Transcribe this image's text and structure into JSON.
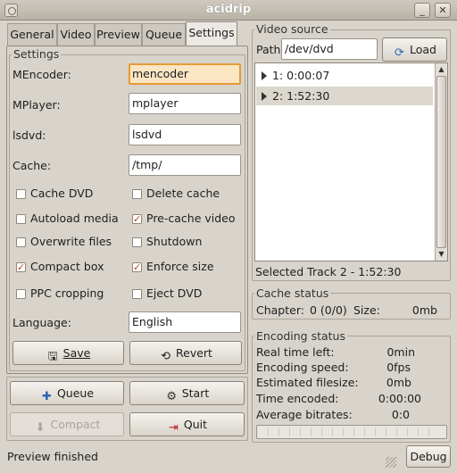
{
  "window": {
    "title": "acidrip",
    "minimize_glyph": "_",
    "close_glyph": "✕"
  },
  "tabs": [
    {
      "label": "General"
    },
    {
      "label": "Video"
    },
    {
      "label": "Preview"
    },
    {
      "label": "Queue"
    },
    {
      "label": "Settings",
      "active": true
    }
  ],
  "settings": {
    "group_label": "Settings",
    "mencoder": {
      "label": "MEncoder:",
      "value": "mencoder"
    },
    "mplayer": {
      "label": "MPlayer:",
      "value": "mplayer"
    },
    "lsdvd": {
      "label": "lsdvd:",
      "value": "lsdvd"
    },
    "cache": {
      "label": "Cache:",
      "value": "/tmp/"
    },
    "checkboxes": [
      {
        "label": "Cache DVD",
        "checked": false
      },
      {
        "label": "Delete cache",
        "checked": false
      },
      {
        "label": "Autoload media",
        "checked": false
      },
      {
        "label": "Pre-cache video",
        "checked": true
      },
      {
        "label": "Overwrite files",
        "checked": false
      },
      {
        "label": "Shutdown",
        "checked": false
      },
      {
        "label": "Compact box",
        "checked": true
      },
      {
        "label": "Enforce size",
        "checked": true
      },
      {
        "label": "PPC cropping",
        "checked": false
      },
      {
        "label": "Eject DVD",
        "checked": false
      }
    ],
    "language": {
      "label": "Language:",
      "value": "English"
    },
    "save_label": "Save",
    "revert_label": "Revert"
  },
  "actions": {
    "queue_label": "Queue",
    "start_label": "Start",
    "compact_label": "Compact",
    "quit_label": "Quit"
  },
  "video_source": {
    "group_label": "Video source",
    "path_label": "Path",
    "path_value": "/dev/dvd",
    "load_label": "Load",
    "tracks": [
      {
        "label": "1: 0:00:07",
        "selected": false
      },
      {
        "label": "2: 1:52:30",
        "selected": true
      }
    ],
    "selected_track": "Selected Track 2 - 1:52:30"
  },
  "cache_status": {
    "group_label": "Cache status",
    "chapter_label": "Chapter:",
    "chapter_value": "0 (0/0)",
    "size_label": "Size:",
    "size_value": "0mb"
  },
  "encoding_status": {
    "group_label": "Encoding status",
    "rows": [
      {
        "label": "Real time left:",
        "value": "0min"
      },
      {
        "label": "Encoding speed:",
        "value": "0fps"
      },
      {
        "label": "Estimated filesize:",
        "value": "0mb"
      },
      {
        "label": "Time encoded:",
        "value": "0:00:00"
      },
      {
        "label": "Average bitrates:",
        "value": "0:0"
      }
    ]
  },
  "statusbar": {
    "text": "Preview finished",
    "debug_label": "Debug"
  },
  "colors": {
    "focus_border": "#e69a34",
    "check_mark": "#b24a12"
  }
}
